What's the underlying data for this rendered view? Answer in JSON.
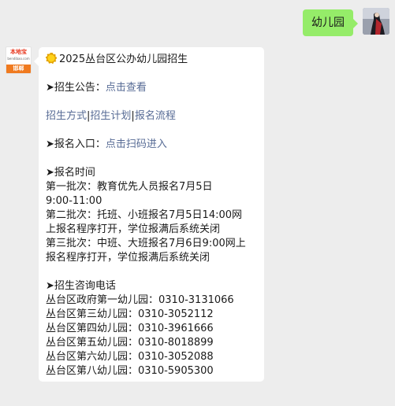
{
  "outgoing": {
    "text": "幼儿园"
  },
  "incoming": {
    "avatar": {
      "top_text": "本地宝",
      "sub_text": "bendibao.com",
      "city_label": "邯郸"
    },
    "icon": "sun-icon",
    "title": "2025丛台区公办幼儿园招生",
    "announcement": {
      "prefix": "➤招生公告：",
      "link": "点击查看"
    },
    "links": {
      "method": "招生方式",
      "sep1": "|",
      "plan": "招生计划",
      "sep2": "|",
      "process": "报名流程"
    },
    "entry": {
      "prefix": "➤报名入口：",
      "link": "点击扫码进入"
    },
    "time": {
      "heading": "➤报名时间",
      "lines": [
        "第一批次：教育优先人员报名7月5日",
        "9:00-11:00",
        "第二批次：托班、小班报名7月5日14:00网",
        "上报名程序打开，学位报满后系统关闭",
        "第三批次：中班、大班报名7月6日9:00网上",
        "报名程序打开，学位报满后系统关闭"
      ]
    },
    "phones": {
      "heading": "➤招生咨询电话",
      "lines": [
        "丛台区政府第一幼儿园：0310-3131066",
        "丛台区第三幼儿园：0310-3052112",
        "丛台区第四幼儿园：0310-3961666",
        "丛台区第五幼儿园：0310-8018899",
        "丛台区第六幼儿园：0310-3052088",
        "丛台区第八幼儿园：0310-5905300"
      ]
    }
  }
}
